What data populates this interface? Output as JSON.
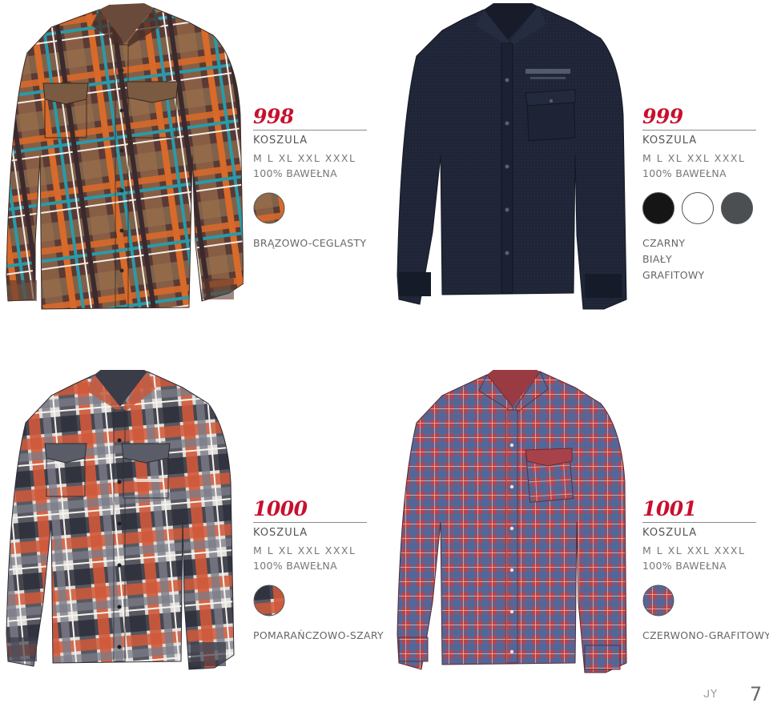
{
  "products": [
    {
      "number": "998",
      "name": "KOSZULA",
      "sizes": "M  L  XL  XXL  XXXL",
      "material": "100% BAWEŁNA",
      "colors": [
        "BRĄZOWO-CEGLASTY"
      ],
      "swatch_colors": [
        "#9a6a48"
      ]
    },
    {
      "number": "999",
      "name": "KOSZULA",
      "sizes": "M  L  XL  XXL  XXXL",
      "material": "100% BAWEŁNA",
      "colors": [
        "CZARNY",
        "BIAŁY",
        "GRAFITOWY"
      ],
      "swatch_colors": [
        "#151515",
        "#ffffff",
        "#4c4f51"
      ]
    },
    {
      "number": "1000",
      "name": "KOSZULA",
      "sizes": "M  L  XL  XXL  XXXL",
      "material": "100% BAWEŁNA",
      "colors": [
        "POMARAŃCZOWO-SZARY"
      ],
      "swatch_colors": [
        "#b05a44"
      ]
    },
    {
      "number": "1001",
      "name": "KOSZULA",
      "sizes": "M  L  XL  XXL  XXXL",
      "material": "100% BAWEŁNA",
      "colors": [
        "CZERWONO-GRAFITOWY"
      ],
      "swatch_colors": [
        "#7a4a5c"
      ]
    }
  ],
  "footer": {
    "logo": "ᒍY",
    "page_number": "7"
  },
  "accent_color": "#c8102e"
}
